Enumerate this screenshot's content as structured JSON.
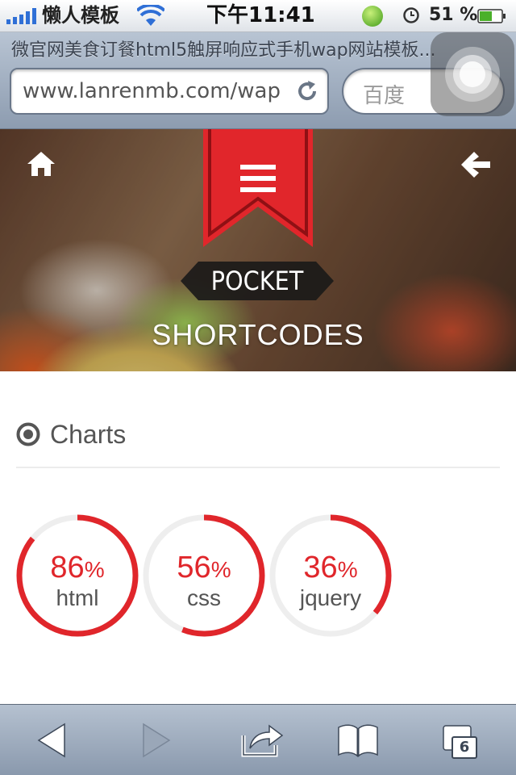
{
  "status_bar": {
    "carrier": "懒人模板",
    "time": "下午11:41",
    "battery_percent": "51 %"
  },
  "browser": {
    "page_title": "微官网美食订餐html5触屏响应式手机wap网站模板...",
    "url": "www.lanrenmb.com/wap",
    "search_placeholder": "百度",
    "tab_count": "6"
  },
  "hero": {
    "badge_text": "POCKET",
    "subtitle": "SHORTCODES"
  },
  "section": {
    "title": "Charts"
  },
  "chart_data": {
    "type": "donut",
    "series": [
      {
        "label": "html",
        "value": 86,
        "display": "86"
      },
      {
        "label": "css",
        "value": 56,
        "display": "56"
      },
      {
        "label": "jquery",
        "value": 36,
        "display": "36"
      }
    ],
    "unit": "%",
    "max": 100
  },
  "colors": {
    "accent": "#e0262b",
    "track": "#eeeeee",
    "label": "#555555"
  },
  "icons": {
    "home": "home-icon",
    "back": "back-arrow-icon",
    "menu": "menu-icon",
    "section": "target-icon"
  }
}
